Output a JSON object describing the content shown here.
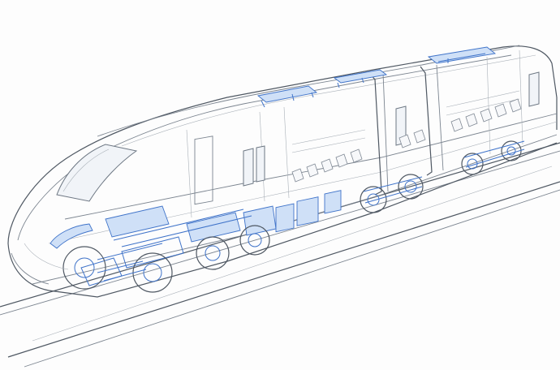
{
  "illustration": {
    "subject": "high-speed-train-cutaway",
    "colors": {
      "background": "#fdfdfd",
      "linework": "#7c8590",
      "equipment_accent": "#3f73c9",
      "equipment_fill": "#cfe0f7"
    }
  }
}
